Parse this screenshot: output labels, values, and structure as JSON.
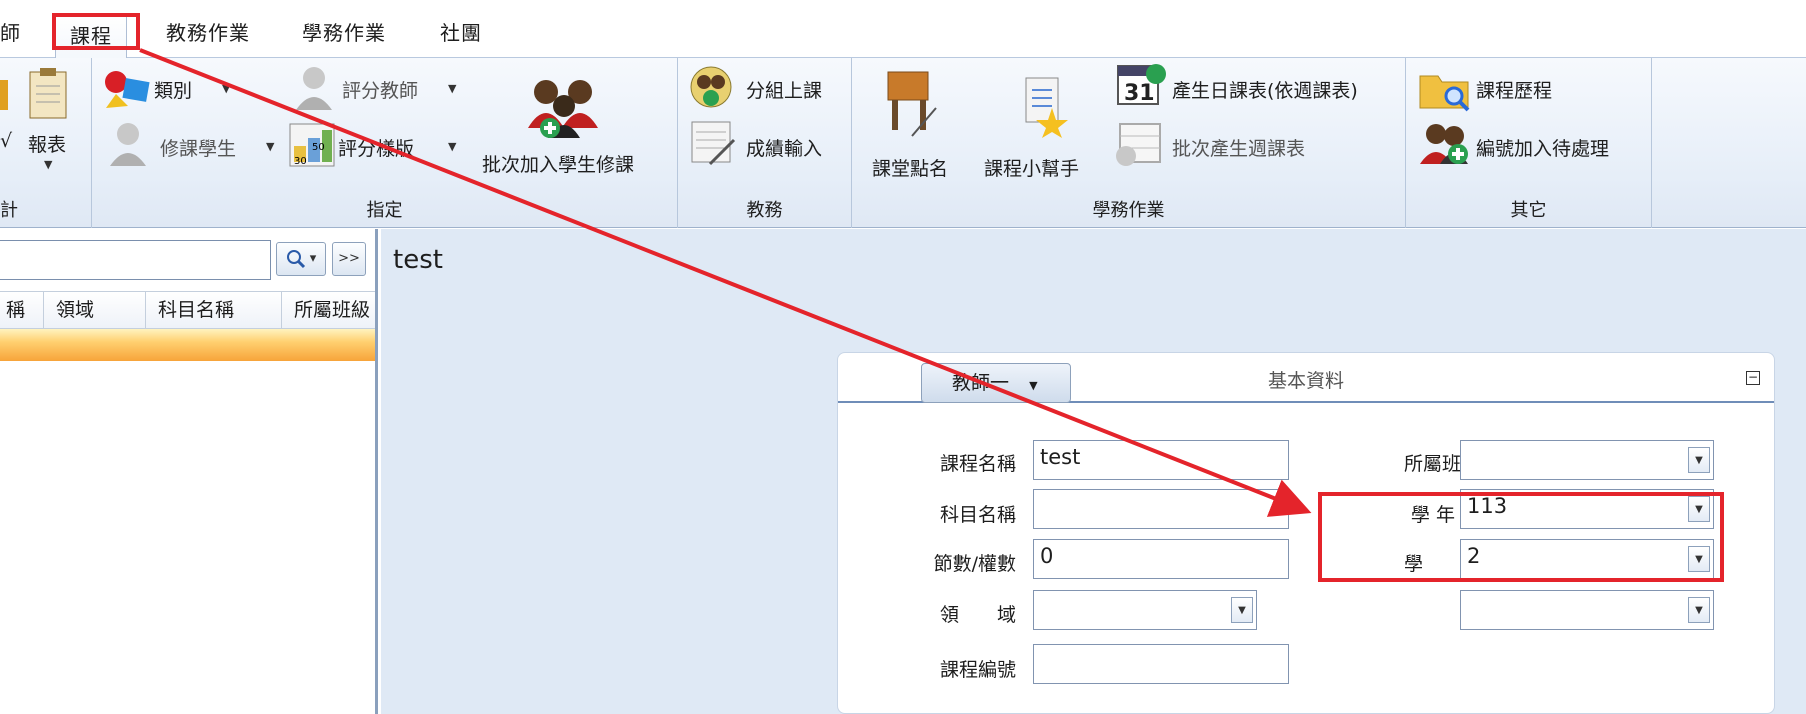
{
  "menu": {
    "tabs": [
      {
        "label": "師"
      },
      {
        "label": "課程"
      },
      {
        "label": "教務作業"
      },
      {
        "label": "學務作業"
      },
      {
        "label": "社團"
      }
    ]
  },
  "ribbon": {
    "group_statistics": {
      "label": "計",
      "report_label": "報表"
    },
    "group_assign": {
      "label": "指定",
      "category_label": "類別",
      "grading_teacher_label": "評分教師",
      "enroll_student_label": "修課學生",
      "grading_template_label": "評分樣版",
      "batch_add_label": "批次加入學生修課"
    },
    "group_academic": {
      "label": "教務",
      "group_class_label": "分組上課",
      "grade_entry_label": "成績輸入"
    },
    "group_student_affairs": {
      "label": "學務作業",
      "roll_call_label": "課堂點名",
      "course_helper_label": "課程小幫手",
      "gen_daily_label": "產生日課表(依週課表)",
      "batch_weekly_label": "批次產生週課表"
    },
    "group_other": {
      "label": "其它",
      "course_history_label": "課程歷程",
      "add_pending_label": "編號加入待處理"
    }
  },
  "left": {
    "search_button": "▾",
    "next_button": ">>",
    "columns": [
      "稱",
      "領域",
      "科目名稱",
      "所屬班級"
    ]
  },
  "detail": {
    "title": "test",
    "card_title": "基本資料",
    "collapse": "−",
    "fields": {
      "course_name": {
        "label": "課程名稱",
        "value": "test"
      },
      "subject_name": {
        "label": "科目名稱",
        "value": ""
      },
      "credits": {
        "label": "節數/權數",
        "value": "0"
      },
      "domain": {
        "label": "領　　域",
        "value": ""
      },
      "course_code": {
        "label": "課程編號",
        "value": ""
      },
      "class": {
        "label": "所屬班級",
        "value": ""
      },
      "school_year": {
        "label": "學 年 度",
        "value": "113"
      },
      "semester": {
        "label": "學　　期",
        "value": "2"
      },
      "teacher": {
        "label": "教師一",
        "value": ""
      }
    }
  },
  "colors": {
    "highlight_red": "#e4242b",
    "ribbon_bg": "#e6eef8",
    "detail_bg": "#dfe9f5",
    "selected_row": "#f7a43a"
  },
  "icons": [
    "report-icon",
    "category-icon",
    "grading-teacher-icon",
    "enroll-student-icon",
    "grading-template-icon",
    "batch-add-icon",
    "group-class-icon",
    "grade-entry-icon",
    "roll-call-icon",
    "course-helper-icon",
    "calendar-icon",
    "weekly-schedule-icon",
    "folder-search-icon",
    "add-pending-icon",
    "search-icon"
  ]
}
